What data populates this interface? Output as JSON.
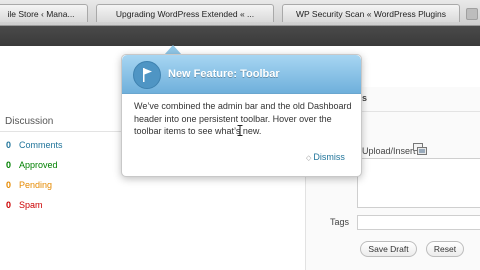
{
  "browser": {
    "tabs": [
      {
        "label": "ile Store ‹ Mana..."
      },
      {
        "label": "Upgrading WordPress Extended « ..."
      },
      {
        "label": "WP Security Scan « WordPress Plugins"
      }
    ]
  },
  "pointer": {
    "title": "New Feature: Toolbar",
    "body": "We’ve combined the admin bar and the old Dashboard header into one persistent toolbar. Hover over the toolbar items to see what’s new.",
    "dismiss_label": "Dismiss",
    "header_colors": [
      "#a7d6f2",
      "#6fb0db"
    ]
  },
  "discussion": {
    "title": "Discussion",
    "items": [
      {
        "count": "0",
        "label": "Comments",
        "color": "#21759b"
      },
      {
        "count": "0",
        "label": "Approved",
        "color": "#008000"
      },
      {
        "count": "0",
        "label": "Pending",
        "color": "#e68a00"
      },
      {
        "count": "0",
        "label": "Spam",
        "color": "#cc0000"
      }
    ]
  },
  "quickpress": {
    "heading_fragment": "s",
    "upload_label": "Upload/Insert",
    "tags_label": "Tags",
    "tags_value": "",
    "save_draft_label": "Save Draft",
    "reset_label": "Reset"
  }
}
